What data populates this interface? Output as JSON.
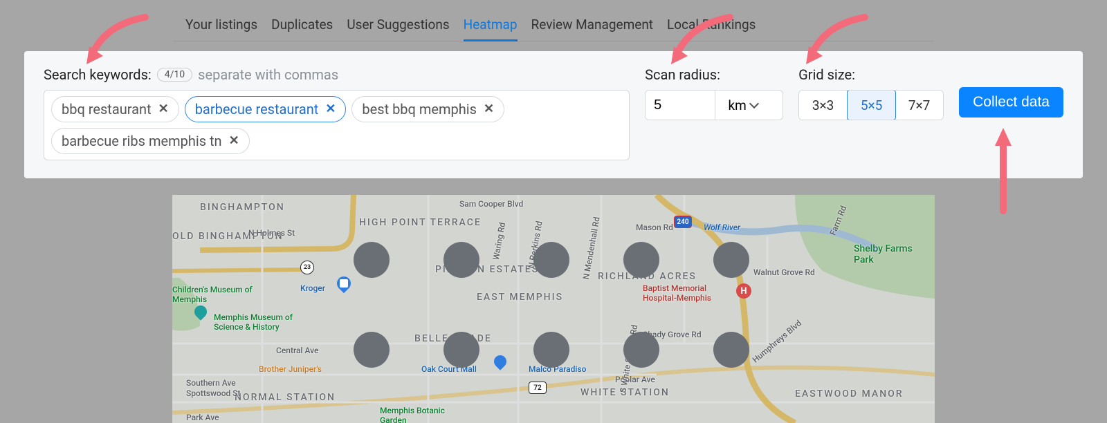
{
  "tabs": {
    "items": [
      {
        "label": "Your listings",
        "active": false
      },
      {
        "label": "Duplicates",
        "active": false
      },
      {
        "label": "User Suggestions",
        "active": false
      },
      {
        "label": "Heatmap",
        "active": true
      },
      {
        "label": "Review Management",
        "active": false
      },
      {
        "label": "Local Rankings",
        "active": false
      }
    ]
  },
  "keywords": {
    "label": "Search keywords:",
    "counter": "4/10",
    "hint": "separate with commas",
    "chips": [
      {
        "label": "bbq restaurant",
        "active": false
      },
      {
        "label": "barbecue restaurant",
        "active": true
      },
      {
        "label": "best bbq memphis",
        "active": false
      },
      {
        "label": "barbecue ribs memphis tn",
        "active": false
      }
    ]
  },
  "radius": {
    "label": "Scan radius:",
    "value": "5",
    "unit": "km"
  },
  "grid": {
    "label": "Grid size:",
    "options": [
      "3×3",
      "5×5",
      "7×7"
    ],
    "selected": "5×5"
  },
  "button": {
    "collect": "Collect data"
  },
  "map": {
    "neighborhoods": [
      "BINGHAMPTON",
      "OLD BINGHAMPTON",
      "HIGH POINT TERRACE",
      "PIDGEON ESTATES",
      "EAST MEMPHIS",
      "RICHLAND ACRES",
      "BELLE MEADE",
      "NORMAL STATION",
      "WHITE STATION",
      "EASTWOOD MANOR"
    ],
    "roads": [
      "N Holmes St",
      "Walnut Grove Rd",
      "Farm Rd",
      "Sam Cooper Blvd",
      "Central Ave",
      "Southern Ave",
      "Park Ave",
      "Poplar Ave",
      "Waring Rd",
      "N Perkins Rd",
      "N Mendenhall Rd",
      "Mason Rd",
      "Shady Grove Rd",
      "Humphreys Blvd",
      "S White Station Rd",
      "Spottswood St",
      "Wolf River"
    ],
    "pois": [
      {
        "name": "Children's Museum of Memphis",
        "type": "museum"
      },
      {
        "name": "Memphis Museum of Science & History",
        "type": "museum"
      },
      {
        "name": "Kroger",
        "type": "store"
      },
      {
        "name": "Brother Juniper's",
        "type": "restaurant"
      },
      {
        "name": "Oak Court Mall",
        "type": "mall"
      },
      {
        "name": "Malco Paradiso",
        "type": "cinema"
      },
      {
        "name": "Baptist Memorial Hospital-Memphis",
        "type": "hospital"
      },
      {
        "name": "Shelby Farms Park",
        "type": "park"
      },
      {
        "name": "Memphis Botanic Garden",
        "type": "park"
      }
    ],
    "highways": [
      "240",
      "72",
      "23"
    ]
  }
}
